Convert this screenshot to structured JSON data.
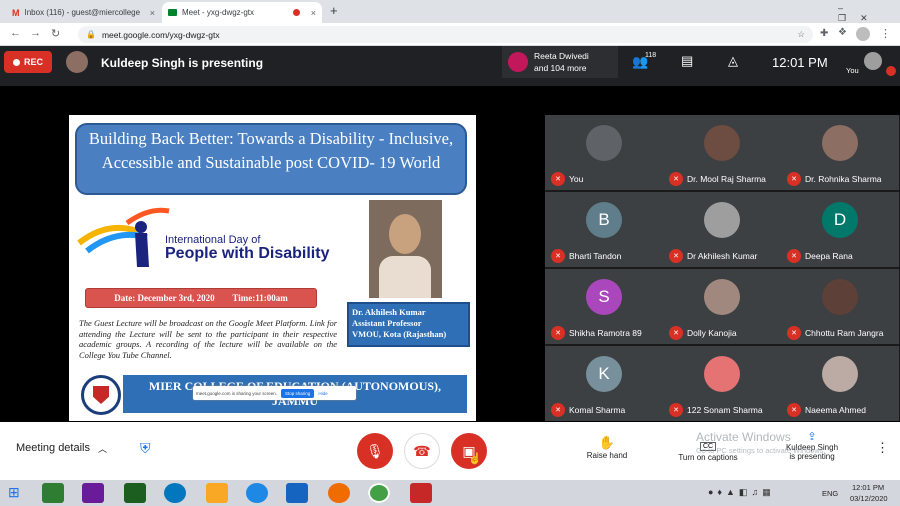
{
  "browser": {
    "tabs": [
      {
        "label": "Inbox (116) - guest@miercollege",
        "close": "×"
      },
      {
        "label": "Meet - yxg-dwgz-gtx",
        "close": "×"
      }
    ],
    "new_tab": "+",
    "url": "meet.google.com/yxg-dwgz-gtx"
  },
  "meet": {
    "rec": "REC",
    "presenter_banner": "Kuldeep Singh is presenting",
    "participants_line1": "Reeta Dwivedi",
    "participants_line2": "and 104 more",
    "people_count": "118",
    "clock": "12:01 PM",
    "you_label": "You"
  },
  "slide": {
    "title": "Building Back Better: Towards a Disability - Inclusive, Accessible and Sustainable post COVID- 19 World",
    "logo_line1": "International Day of",
    "logo_line2": "People with Disability",
    "date": "Date: December 3rd, 2020        Time:11:00am",
    "speaker_name": "Dr. Akhilesh Kumar",
    "speaker_role": "Assistant Professor",
    "speaker_org": "VMOU, Kota (Rajasthan)",
    "body": "The Guest Lecture will be broadcast on the Google Meet Platform. Link for attending the Lecture will be sent to the participant in their respective academic groups. A recording of the lecture will be available on the College You Tube Channel.",
    "college": "MIER COLLEGE OF EDUCATION (AUTONOMOUS), JAMMU",
    "share_notice": "meet.google.com is sharing your screen.",
    "stop_sharing": "Stop sharing",
    "hide": "Hide"
  },
  "participants": [
    {
      "name": "You",
      "initial": "",
      "color": "#5f6368"
    },
    {
      "name": "Dr. Mool Raj Sharma",
      "initial": "",
      "color": "#6d4c41"
    },
    {
      "name": "Dr. Rohnika Sharma",
      "initial": "",
      "color": "#8d6e63"
    },
    {
      "name": "Bharti Tandon",
      "initial": "B",
      "color": "#607d8b"
    },
    {
      "name": "Dr Akhilesh Kumar",
      "initial": "",
      "color": "#9e9e9e"
    },
    {
      "name": "Deepa Rana",
      "initial": "D",
      "color": "#00796b"
    },
    {
      "name": "Shikha Ramotra 89",
      "initial": "S",
      "color": "#ab47bc"
    },
    {
      "name": "Dolly Kanojia",
      "initial": "",
      "color": "#a1887f"
    },
    {
      "name": "Chhottu Ram Jangra",
      "initial": "",
      "color": "#5d4037"
    },
    {
      "name": "Komal Sharma",
      "initial": "K",
      "color": "#78909c"
    },
    {
      "name": "122 Sonam Sharma",
      "initial": "",
      "color": "#e57373"
    },
    {
      "name": "Naeema Ahmed",
      "initial": "",
      "color": "#bcaaa4"
    }
  ],
  "controls": {
    "meeting_details": "Meeting details",
    "raise_hand": "Raise hand",
    "captions": "Turn on captions",
    "cc": "CC",
    "presenting_line1": "Kuldeep Singh",
    "presenting_line2": "is presenting",
    "activate_title": "Activate Windows",
    "activate_sub": "Go to PC settings to activate Windows."
  },
  "taskbar": {
    "lang": "ENG",
    "time": "12:01 PM",
    "date": "03/12/2020"
  }
}
